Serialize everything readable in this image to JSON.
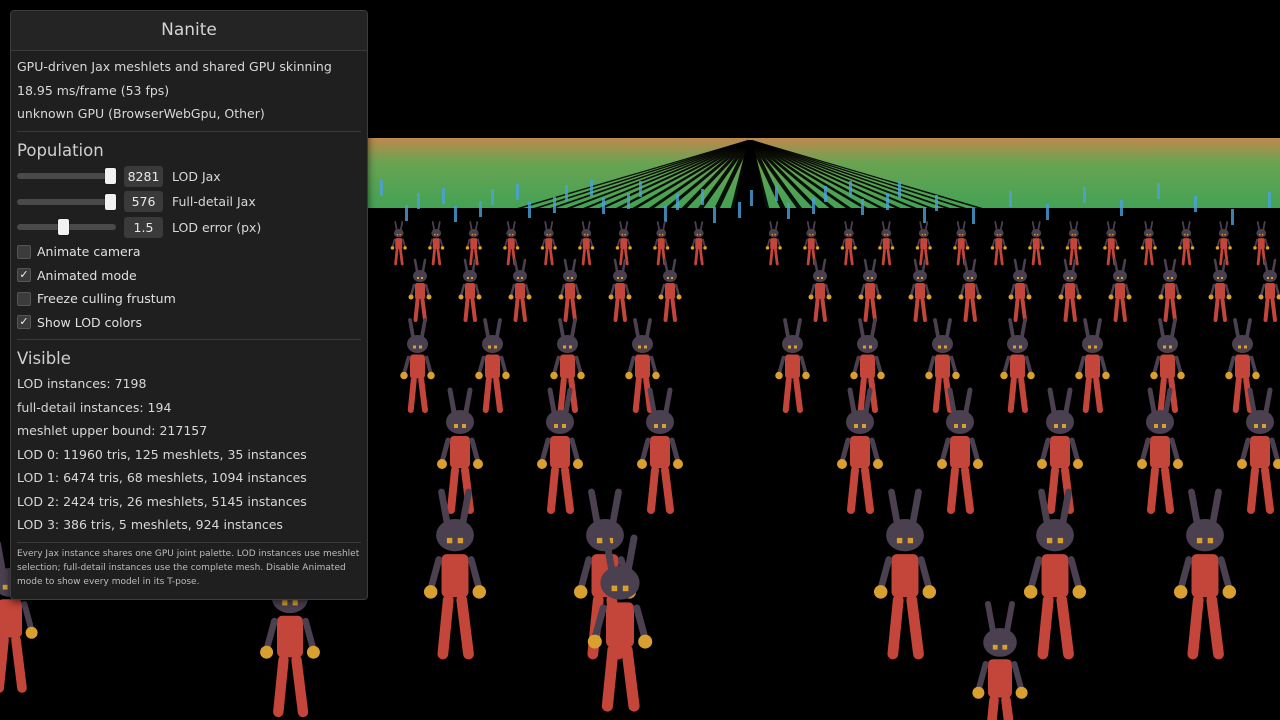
{
  "panel": {
    "title": "Nanite",
    "info": [
      "GPU-driven Jax meshlets and shared GPU skinning",
      "18.95 ms/frame (53 fps)",
      "unknown GPU (BrowserWebGpu, Other)"
    ],
    "population": {
      "heading": "Population",
      "sliders": [
        {
          "value": "8281",
          "label": "LOD Jax",
          "level": 1.0
        },
        {
          "value": "576",
          "label": "Full-detail Jax",
          "level": 1.0
        },
        {
          "value": "1.5",
          "label": "LOD error (px)",
          "level": 0.5
        }
      ],
      "checkboxes": [
        {
          "label": "Animate camera",
          "checked": false
        },
        {
          "label": "Animated mode",
          "checked": true
        },
        {
          "label": "Freeze culling frustum",
          "checked": false
        },
        {
          "label": "Show LOD colors",
          "checked": true
        }
      ]
    },
    "visible": {
      "heading": "Visible",
      "stats": [
        "LOD instances: 7198",
        "full-detail instances: 194",
        "meshlet upper bound: 217157",
        "LOD 0: 11960 tris, 125 meshlets, 35 instances",
        "LOD 1: 6474 tris, 68 meshlets, 1094 instances",
        "LOD 2: 2424 tris, 26 meshlets, 5145 instances",
        "LOD 3: 386 tris, 5 meshlets, 924 instances"
      ]
    },
    "note": "Every Jax instance shares one GPU joint palette. LOD instances use meshlet selection; full-detail instances use the complete mesh. Disable Animated mode to show every model in its T-pose."
  },
  "colors": {
    "background": "#000000",
    "panel": "#1f1f1f",
    "lod_green": "#5cc96a",
    "lod_orange": "#e0a05a",
    "lod_blue": "#4aa3d9",
    "jax_red": "#c4453a",
    "jax_purple": "#4a4050",
    "jax_glove": "#d9a030"
  }
}
